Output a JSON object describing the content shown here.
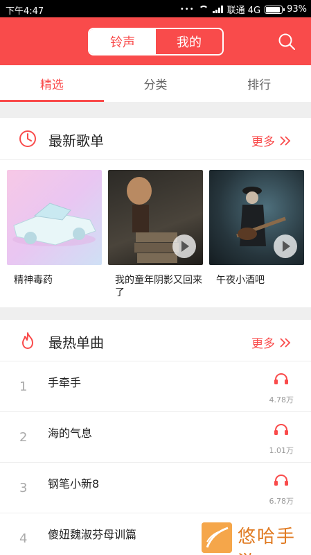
{
  "status": {
    "time": "下午4:47",
    "carrier": "联通 4G",
    "battery": "93%",
    "battery_level": 0.93
  },
  "header": {
    "tab_ringtone": "铃声",
    "tab_mine": "我的"
  },
  "tabs": [
    {
      "label": "精选"
    },
    {
      "label": "分类"
    },
    {
      "label": "排行"
    }
  ],
  "playlists": {
    "title": "最新歌单",
    "more": "更多",
    "items": [
      {
        "name": "精神毒药"
      },
      {
        "name": "我的童年阴影又回来了"
      },
      {
        "name": "午夜小酒吧"
      }
    ]
  },
  "hot": {
    "title": "最热单曲",
    "more": "更多",
    "songs": [
      {
        "rank": "1",
        "title": "手牵手",
        "count": "4.78万"
      },
      {
        "rank": "2",
        "title": "海的气息",
        "count": "1.01万"
      },
      {
        "rank": "3",
        "title": "钢笔小新8",
        "count": "6.78万"
      },
      {
        "rank": "4",
        "title": "傻妞魏淑芬母训篇",
        "count": ""
      }
    ]
  },
  "watermark": {
    "text": "悠哈手游"
  },
  "colors": {
    "accent": "#f94b4b"
  }
}
